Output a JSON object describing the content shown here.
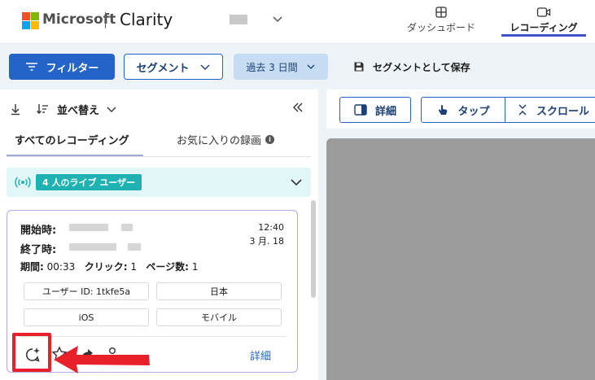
{
  "header": {
    "brand": "Microsoft",
    "product": "Clarity",
    "nav": [
      {
        "label": "ダッシュボード"
      },
      {
        "label": "レコーディング"
      }
    ]
  },
  "toolbar": {
    "filter_label": "フィルター",
    "segment_label": "セグメント",
    "range_label": "過去 3 日間",
    "save_segment_label": "セグメントとして保存"
  },
  "list": {
    "sort_label": "並べ替え",
    "tabs": [
      {
        "label": "すべてのレコーディング"
      },
      {
        "label": "お気に入りの録画"
      }
    ],
    "live_badge": "4 人のライブ ユーザー"
  },
  "card": {
    "start_label": "開始時:",
    "end_label": "終了時:",
    "time": "12:40",
    "date": "3 月. 18",
    "duration_label": "期間:",
    "duration_value": "00:33",
    "clicks_label": "クリック:",
    "clicks_value": "1",
    "pages_label": "ページ数:",
    "pages_value": "1",
    "chips": [
      {
        "label": "ユーザー ID: 1tkfe5a"
      },
      {
        "label": "日本"
      },
      {
        "label": "iOS"
      },
      {
        "label": "モバイル"
      }
    ],
    "detail_link": "詳細"
  },
  "player": {
    "detail_label": "詳細",
    "tap_label": "タップ",
    "scroll_label": "スクロール"
  },
  "colors": {
    "primary": "#2464c8",
    "live": "#1fb2b2",
    "highlight": "#e8202a"
  }
}
